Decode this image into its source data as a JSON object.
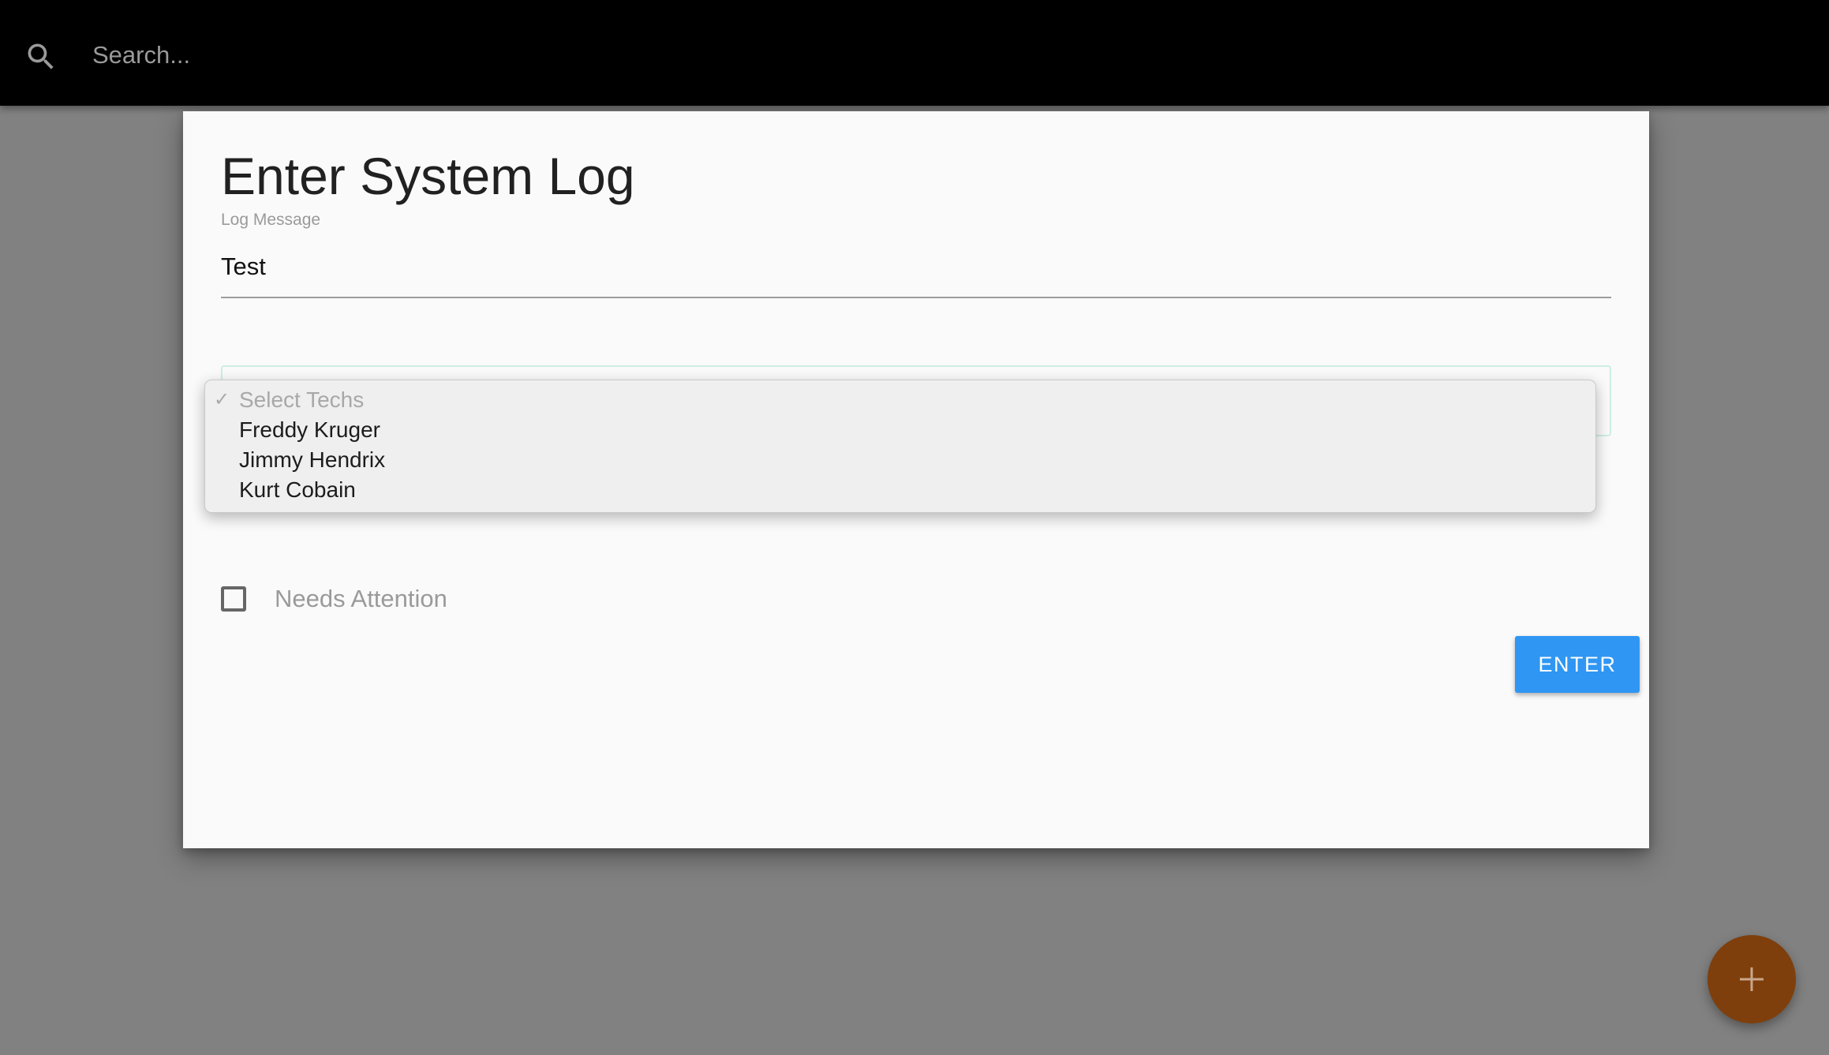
{
  "search": {
    "placeholder": "Search...",
    "icon": "search-icon"
  },
  "dialog": {
    "title": "Enter System Log",
    "log_message": {
      "label": "Log Message",
      "value": "Test"
    },
    "techs_select": {
      "placeholder": "Select Techs",
      "options": [
        "Select Techs",
        "Freddy Kruger",
        "Jimmy Hendrix",
        "Kurt Cobain"
      ],
      "selected": "Select Techs"
    },
    "needs_attention": {
      "label": "Needs Attention",
      "checked": false
    },
    "enter_button": "ENTER"
  },
  "fab": {
    "icon": "plus-icon",
    "color": "#7e3f0c"
  },
  "colors": {
    "topbar": "#000000",
    "backdrop": "#818181",
    "dialog": "#fafafa",
    "primary_button": "#2f96f3",
    "select_border": "#cdeee3"
  }
}
